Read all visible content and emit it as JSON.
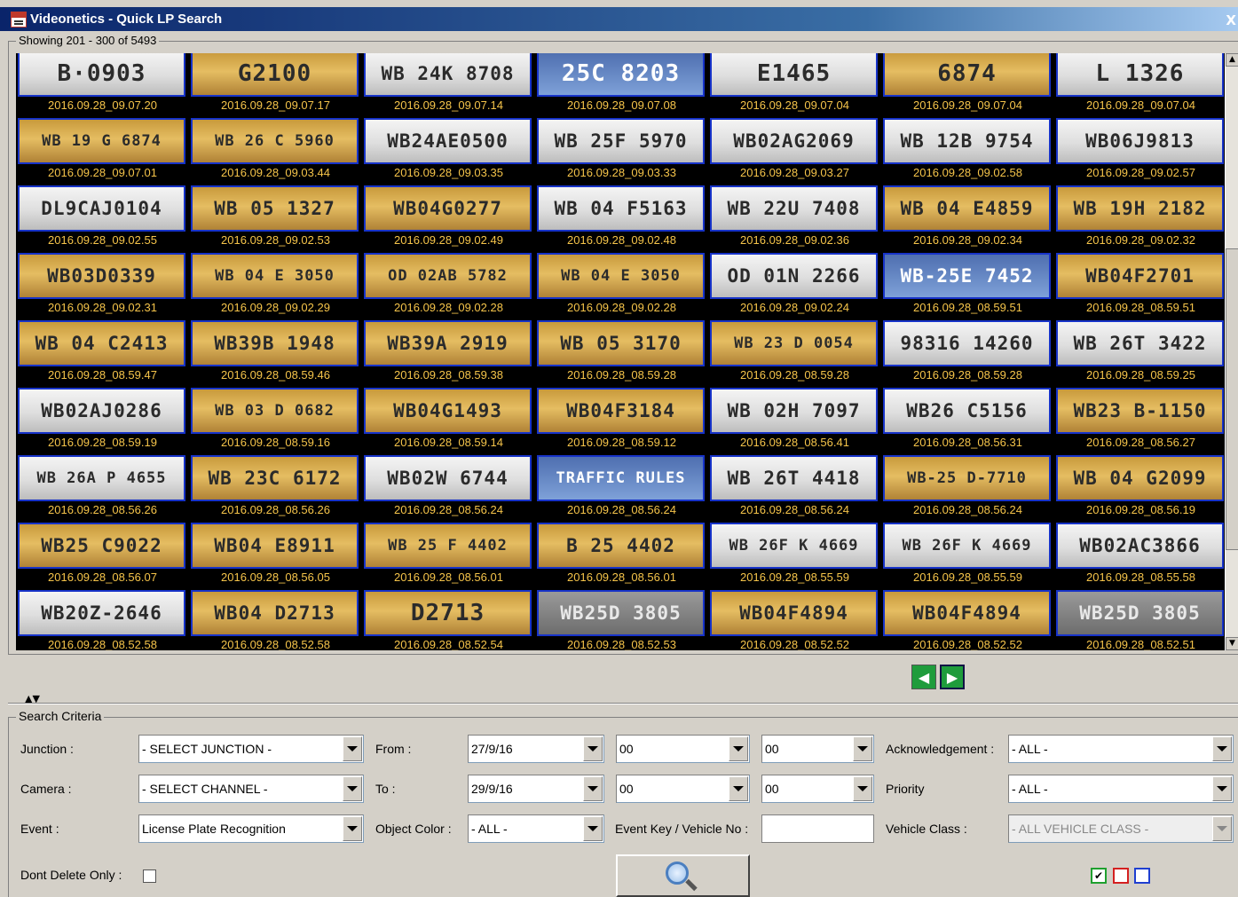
{
  "window": {
    "title": "Videonetics - Quick LP Search",
    "close_label": "X"
  },
  "results": {
    "showing_label": "Showing 201 - 300 of 5493",
    "tiles": [
      {
        "plate": "B·0903",
        "style": "white",
        "time": "2016.09.28_09.07.20"
      },
      {
        "plate": "G2100",
        "style": "yellow",
        "time": "2016.09.28_09.07.17"
      },
      {
        "plate": "WB 24K 8708",
        "style": "white",
        "time": "2016.09.28_09.07.14"
      },
      {
        "plate": "25C 8203",
        "style": "blue",
        "time": "2016.09.28_09.07.08"
      },
      {
        "plate": "E1465",
        "style": "white",
        "time": "2016.09.28_09.07.04"
      },
      {
        "plate": "6874",
        "style": "yellow",
        "time": "2016.09.28_09.07.04"
      },
      {
        "plate": "L 1326",
        "style": "white",
        "time": "2016.09.28_09.07.04"
      },
      {
        "plate": "WB 19 G 6874",
        "style": "yellow",
        "time": "2016.09.28_09.07.01"
      },
      {
        "plate": "WB 26 C 5960",
        "style": "yellow",
        "time": "2016.09.28_09.03.44"
      },
      {
        "plate": "WB24AE0500",
        "style": "white",
        "time": "2016.09.28_09.03.35"
      },
      {
        "plate": "WB 25F 5970",
        "style": "white",
        "time": "2016.09.28_09.03.33"
      },
      {
        "plate": "WB02AG2069",
        "style": "white",
        "time": "2016.09.28_09.03.27"
      },
      {
        "plate": "WB 12B 9754",
        "style": "white",
        "time": "2016.09.28_09.02.58"
      },
      {
        "plate": "WB06J9813",
        "style": "white",
        "time": "2016.09.28_09.02.57"
      },
      {
        "plate": "DL9CAJ0104",
        "style": "white",
        "time": "2016.09.28_09.02.55"
      },
      {
        "plate": "WB 05 1327",
        "style": "yellow",
        "time": "2016.09.28_09.02.53"
      },
      {
        "plate": "WB04G0277",
        "style": "yellow",
        "time": "2016.09.28_09.02.49"
      },
      {
        "plate": "WB 04 F5163",
        "style": "white",
        "time": "2016.09.28_09.02.48"
      },
      {
        "plate": "WB 22U 7408",
        "style": "white",
        "time": "2016.09.28_09.02.36"
      },
      {
        "plate": "WB 04 E4859",
        "style": "yellow",
        "time": "2016.09.28_09.02.34"
      },
      {
        "plate": "WB 19H 2182",
        "style": "yellow",
        "time": "2016.09.28_09.02.32"
      },
      {
        "plate": "WB03D0339",
        "style": "yellow",
        "time": "2016.09.28_09.02.31"
      },
      {
        "plate": "WB 04 E 3050",
        "style": "yellow",
        "time": "2016.09.28_09.02.29"
      },
      {
        "plate": "OD 02AB 5782",
        "style": "yellow",
        "time": "2016.09.28_09.02.28"
      },
      {
        "plate": "WB 04 E 3050",
        "style": "yellow",
        "time": "2016.09.28_09.02.28"
      },
      {
        "plate": "OD 01N 2266",
        "style": "white",
        "time": "2016.09.28_09.02.24"
      },
      {
        "plate": "WB-25E 7452",
        "style": "blue",
        "time": "2016.09.28_08.59.51"
      },
      {
        "plate": "WB04F2701",
        "style": "yellow",
        "time": "2016.09.28_08.59.51"
      },
      {
        "plate": "WB 04 C2413",
        "style": "yellow",
        "time": "2016.09.28_08.59.47"
      },
      {
        "plate": "WB39B 1948",
        "style": "yellow",
        "time": "2016.09.28_08.59.46"
      },
      {
        "plate": "WB39A 2919",
        "style": "yellow",
        "time": "2016.09.28_08.59.38"
      },
      {
        "plate": "WB 05 3170",
        "style": "yellow",
        "time": "2016.09.28_08.59.28"
      },
      {
        "plate": "WB 23 D 0054",
        "style": "yellow",
        "time": "2016.09.28_08.59.28"
      },
      {
        "plate": "98316 14260",
        "style": "white",
        "time": "2016.09.28_08.59.28"
      },
      {
        "plate": "WB 26T 3422",
        "style": "white",
        "time": "2016.09.28_08.59.25"
      },
      {
        "plate": "WB02AJ0286",
        "style": "white",
        "time": "2016.09.28_08.59.19"
      },
      {
        "plate": "WB 03 D 0682",
        "style": "yellow",
        "time": "2016.09.28_08.59.16"
      },
      {
        "plate": "WB04G1493",
        "style": "yellow",
        "time": "2016.09.28_08.59.14"
      },
      {
        "plate": "WB04F3184",
        "style": "yellow",
        "time": "2016.09.28_08.59.12"
      },
      {
        "plate": "WB 02H 7097",
        "style": "white",
        "time": "2016.09.28_08.56.41"
      },
      {
        "plate": "WB26 C5156",
        "style": "white",
        "time": "2016.09.28_08.56.31"
      },
      {
        "plate": "WB23 B-1150",
        "style": "yellow",
        "time": "2016.09.28_08.56.27"
      },
      {
        "plate": "WB 26A P 4655",
        "style": "white",
        "time": "2016.09.28_08.56.26"
      },
      {
        "plate": "WB 23C 6172",
        "style": "yellow",
        "time": "2016.09.28_08.56.26"
      },
      {
        "plate": "WB02W 6744",
        "style": "white",
        "time": "2016.09.28_08.56.24"
      },
      {
        "plate": "TRAFFIC RULES",
        "style": "blue",
        "time": "2016.09.28_08.56.24"
      },
      {
        "plate": "WB 26T 4418",
        "style": "white",
        "time": "2016.09.28_08.56.24"
      },
      {
        "plate": "WB-25 D-7710",
        "style": "yellow",
        "time": "2016.09.28_08.56.24"
      },
      {
        "plate": "WB 04 G2099",
        "style": "yellow",
        "time": "2016.09.28_08.56.19"
      },
      {
        "plate": "WB25 C9022",
        "style": "yellow",
        "time": "2016.09.28_08.56.07"
      },
      {
        "plate": "WB04 E8911",
        "style": "yellow",
        "time": "2016.09.28_08.56.05"
      },
      {
        "plate": "WB 25 F 4402",
        "style": "yellow",
        "time": "2016.09.28_08.56.01"
      },
      {
        "plate": "B 25 4402",
        "style": "yellow",
        "time": "2016.09.28_08.56.01"
      },
      {
        "plate": "WB 26F K 4669",
        "style": "white",
        "time": "2016.09.28_08.55.59"
      },
      {
        "plate": "WB 26F K 4669",
        "style": "white",
        "time": "2016.09.28_08.55.59"
      },
      {
        "plate": "WB02AC3866",
        "style": "white",
        "time": "2016.09.28_08.55.58"
      },
      {
        "plate": "WB20Z-2646",
        "style": "white",
        "time": "2016.09.28_08.52.58"
      },
      {
        "plate": "WB04 D2713",
        "style": "yellow",
        "time": "2016.09.28_08.52.58"
      },
      {
        "plate": "D2713",
        "style": "yellow",
        "time": "2016.09.28_08.52.54"
      },
      {
        "plate": "WB25D 3805",
        "style": "gray",
        "time": "2016.09.28_08.52.53"
      },
      {
        "plate": "WB04F4894",
        "style": "yellow",
        "time": "2016.09.28_08.52.52"
      },
      {
        "plate": "WB04F4894",
        "style": "yellow",
        "time": "2016.09.28_08.52.52"
      },
      {
        "plate": "WB25D 3805",
        "style": "gray",
        "time": "2016.09.28_08.52.51"
      }
    ]
  },
  "nav": {
    "prev_icon": "arrow-left-icon",
    "next_icon": "arrow-right-icon",
    "prev_glyph": "◀",
    "next_glyph": "▶"
  },
  "criteria": {
    "group_label": "Search Criteria",
    "junction": {
      "label": "Junction :",
      "value": "- SELECT JUNCTION -"
    },
    "camera": {
      "label": "Camera :",
      "value": "- SELECT CHANNEL -"
    },
    "event": {
      "label": "Event :",
      "value": "License Plate Recognition"
    },
    "dont_delete": {
      "label": "Dont Delete Only :",
      "checked": false
    },
    "from": {
      "label": "From :",
      "date": "27/9/16",
      "hour": "00",
      "minute": "00"
    },
    "to": {
      "label": "To :",
      "date": "29/9/16",
      "hour": "00",
      "minute": "00"
    },
    "object_color": {
      "label": "Object Color :",
      "value": "- ALL -"
    },
    "event_key": {
      "label": "Event Key / Vehicle No :",
      "value": ""
    },
    "acknowledgement": {
      "label": "Acknowledgement :",
      "value": "- ALL -"
    },
    "priority": {
      "label": "Priority",
      "value": "- ALL -"
    },
    "vehicle_class": {
      "label": "Vehicle Class :",
      "value": "- ALL VEHICLE CLASS -"
    },
    "search_icon": "magnifier-icon",
    "color_boxes": [
      {
        "name": "green",
        "color": "#1fa02f",
        "checked": true
      },
      {
        "name": "red",
        "color": "#d42020",
        "checked": false
      },
      {
        "name": "blue",
        "color": "#1f3fd0",
        "checked": false
      }
    ]
  }
}
